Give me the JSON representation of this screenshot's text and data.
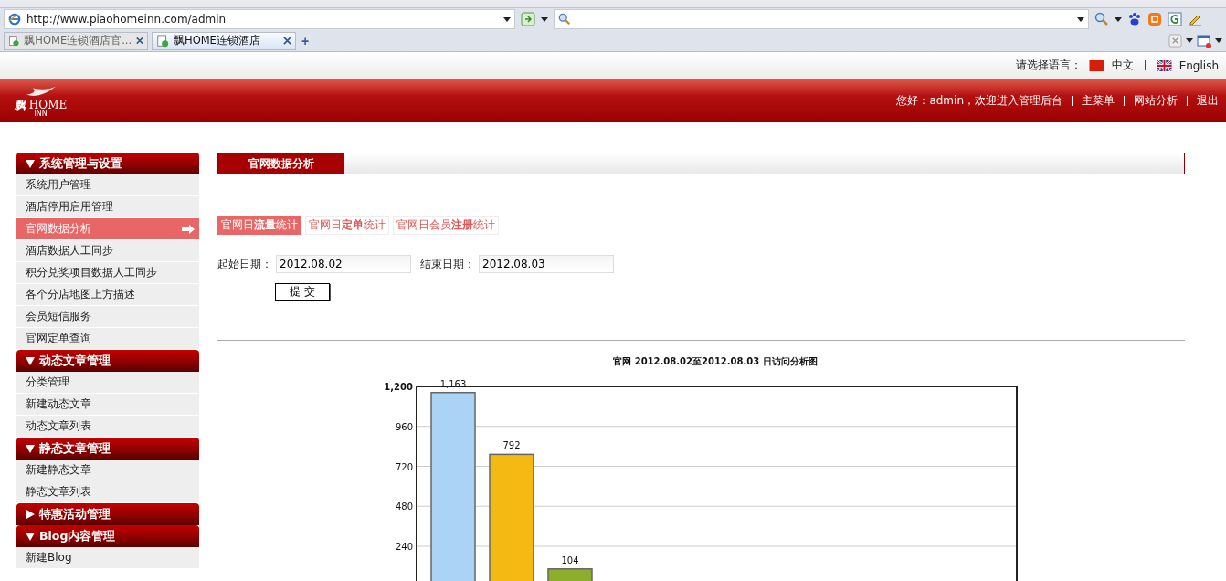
{
  "browser": {
    "address": "http://www.piaohomeinn.com/admin",
    "tabs": [
      {
        "title": "飘HOME连锁酒店官...",
        "selected": false
      },
      {
        "title": "飘HOME连锁酒店",
        "selected": true
      }
    ],
    "new_tab": "+"
  },
  "language_bar": {
    "label": "请选择语言：",
    "options": [
      {
        "label": "中文"
      },
      {
        "label": "English"
      }
    ]
  },
  "header": {
    "logo_text": "飘",
    "logo_word": "HOME",
    "logo_sub": "INN",
    "greeting": "您好：admin，欢迎进入管理后台",
    "links": [
      "主菜单",
      "网站分析",
      "退出"
    ]
  },
  "sidebar": {
    "groups": [
      {
        "title": "系统管理与设置",
        "expanded": true,
        "items": [
          {
            "label": "系统用户管理",
            "selected": false
          },
          {
            "label": "酒店停用启用管理",
            "selected": false
          },
          {
            "label": "官网数据分析",
            "selected": true
          },
          {
            "label": "酒店数据人工同步",
            "selected": false
          },
          {
            "label": "积分兑奖项目数据人工同步",
            "selected": false
          },
          {
            "label": "各个分店地图上方描述",
            "selected": false
          },
          {
            "label": "会员短信服务",
            "selected": false
          },
          {
            "label": "官网定单查询",
            "selected": false
          }
        ]
      },
      {
        "title": "动态文章管理",
        "expanded": true,
        "items": [
          {
            "label": "分类管理",
            "selected": false
          },
          {
            "label": "新建动态文章",
            "selected": false
          },
          {
            "label": "动态文章列表",
            "selected": false
          }
        ]
      },
      {
        "title": "静态文章管理",
        "expanded": true,
        "items": [
          {
            "label": "新建静态文章",
            "selected": false
          },
          {
            "label": "静态文章列表",
            "selected": false
          }
        ]
      },
      {
        "title": "特惠活动管理",
        "expanded": false
      },
      {
        "title": "Blog内容管理",
        "expanded": true,
        "items": [
          {
            "label": "新建Blog",
            "selected": false
          }
        ]
      }
    ]
  },
  "main": {
    "title": "官网数据分析",
    "stat_tabs": [
      {
        "label": "官网日**流量**统计",
        "selected": true
      },
      {
        "label": "官网日**定单**统计",
        "selected": false
      },
      {
        "label": "官网日会员**注册**统计",
        "selected": false
      }
    ],
    "start_label": "起始日期：",
    "start_value": "2012.08.02",
    "end_label": "结束日期：",
    "end_value": "2012.08.03",
    "submit": "提 交",
    "chart_data": {
      "type": "bar",
      "title": "官网 2012.08.02至2012.08.03 日访问分析图",
      "stacked": true,
      "grid": true,
      "series": [
        {
          "color": "#aad3f5",
          "values": [
            1163,
            null,
            null
          ]
        },
        {
          "color": "#f4b912",
          "values": [
            null,
            792,
            null
          ]
        },
        {
          "color": "#8cae2c",
          "values": [
            null,
            null,
            104
          ]
        }
      ],
      "ylim": [
        0,
        1200
      ],
      "yticks": [
        {
          "value": 240,
          "label": "240"
        },
        {
          "value": 480,
          "label": "480"
        },
        {
          "value": 720,
          "label": "720"
        },
        {
          "value": 960,
          "label": "960"
        },
        {
          "value": 1200,
          "label": "1,200"
        }
      ],
      "value_labels": [
        "1,163",
        "792",
        "104"
      ]
    }
  }
}
